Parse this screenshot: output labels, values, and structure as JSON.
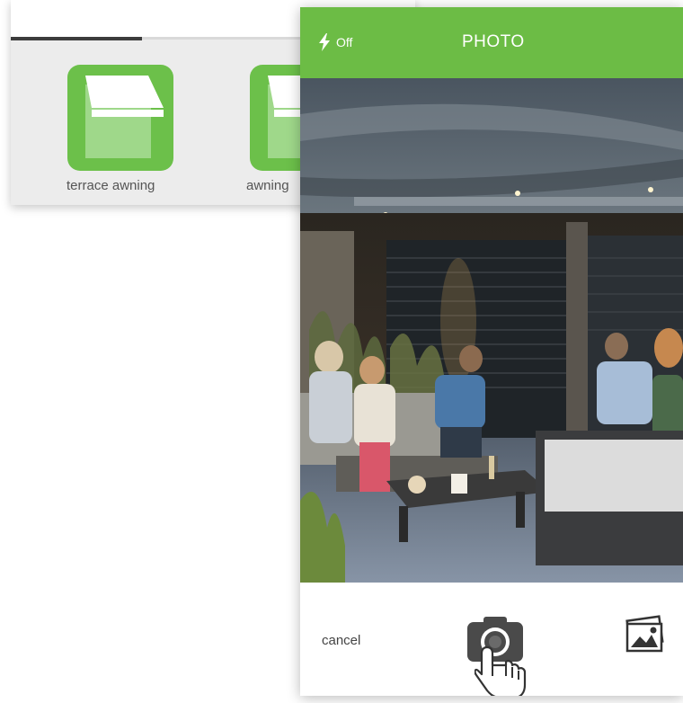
{
  "background_app": {
    "tiles": [
      {
        "label": "terrace awning"
      },
      {
        "label": "awning"
      }
    ]
  },
  "camera": {
    "title": "PHOTO",
    "flash": {
      "label": "Off"
    },
    "footer": {
      "cancel_label": "cancel"
    }
  },
  "colors": {
    "brand_green": "#6cbc45",
    "tile_green": "#6cc04a"
  },
  "icons": [
    "lightning-icon",
    "camera-icon",
    "gallery-icon",
    "hand-pointer-icon",
    "awning-icon"
  ]
}
